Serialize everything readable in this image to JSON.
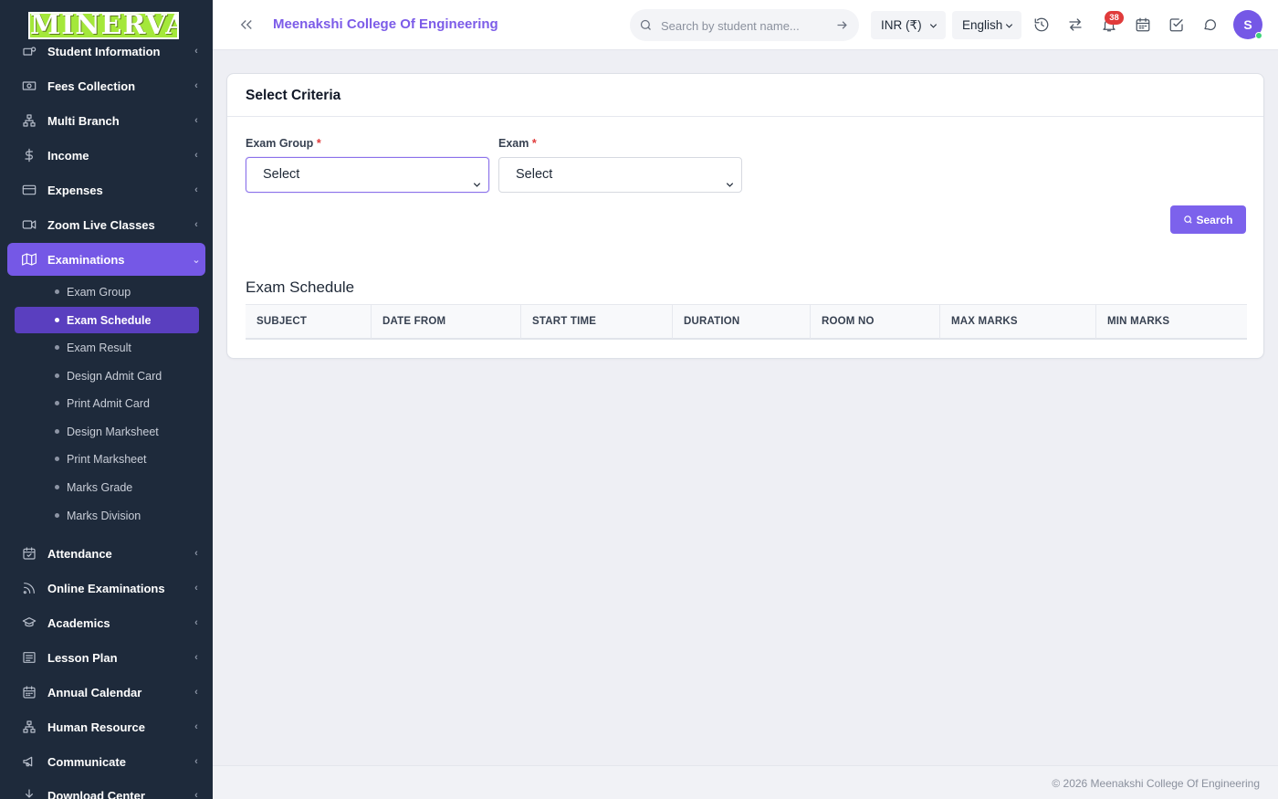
{
  "brand": {
    "logo_text": "MINERVA"
  },
  "sidebar": {
    "items": [
      {
        "label": "Student Information",
        "icon": "student-info-icon"
      },
      {
        "label": "Fees Collection",
        "icon": "money-icon"
      },
      {
        "label": "Multi Branch",
        "icon": "sitemap-icon"
      },
      {
        "label": "Income",
        "icon": "dollar-icon"
      },
      {
        "label": "Expenses",
        "icon": "credit-card-icon"
      },
      {
        "label": "Zoom Live Classes",
        "icon": "video-icon"
      },
      {
        "label": "Examinations",
        "icon": "map-icon"
      },
      {
        "label": "Attendance",
        "icon": "calendar-check-icon"
      },
      {
        "label": "Online Examinations",
        "icon": "rss-icon"
      },
      {
        "label": "Academics",
        "icon": "graduation-cap-icon"
      },
      {
        "label": "Lesson Plan",
        "icon": "list-icon"
      },
      {
        "label": "Annual Calendar",
        "icon": "calendar-icon"
      },
      {
        "label": "Human Resource",
        "icon": "sitemap-icon"
      },
      {
        "label": "Communicate",
        "icon": "bullhorn-icon"
      },
      {
        "label": "Download Center",
        "icon": "download-icon"
      }
    ],
    "active_item": "Examinations",
    "sub_items": [
      {
        "label": "Exam Group"
      },
      {
        "label": "Exam Schedule"
      },
      {
        "label": "Exam Result"
      },
      {
        "label": "Design Admit Card"
      },
      {
        "label": "Print Admit Card"
      },
      {
        "label": "Design Marksheet"
      },
      {
        "label": "Print Marksheet"
      },
      {
        "label": "Marks Grade"
      },
      {
        "label": "Marks Division"
      }
    ],
    "active_sub_item": "Exam Schedule"
  },
  "header": {
    "college_name": "Meenakshi College Of Engineering",
    "search_placeholder": "Search by student name...",
    "currency": "INR (₹)",
    "language": "English",
    "notification_count": "38",
    "user_initial": "S",
    "icons": [
      "history-icon",
      "swap-icon",
      "bell-icon",
      "calendar-icon",
      "check-square-icon",
      "chat-icon"
    ]
  },
  "criteria": {
    "title": "Select Criteria",
    "exam_group_label": "Exam Group",
    "exam_label": "Exam",
    "required_mark": "*",
    "exam_group_value": "Select",
    "exam_value": "Select",
    "search_button": "Search"
  },
  "schedule": {
    "title": "Exam Schedule",
    "columns": [
      "SUBJECT",
      "DATE FROM",
      "START TIME",
      "DURATION",
      "ROOM NO",
      "MAX MARKS",
      "MIN MARKS"
    ]
  },
  "footer": {
    "text": "© 2026 Meenakshi College Of Engineering"
  },
  "colors": {
    "accent": "#7558e6",
    "sidebar_bg": "#1e2a3b",
    "badge": "#e03b3b"
  }
}
